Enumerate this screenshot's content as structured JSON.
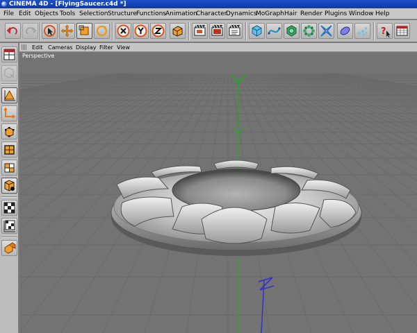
{
  "window": {
    "title": "CINEMA 4D - [FlyingSaucer.c4d *]"
  },
  "menubar": {
    "items": [
      "File",
      "Edit",
      "Objects",
      "Tools",
      "Selection",
      "Structure",
      "Functions",
      "Animation",
      "Character",
      "Dynamics",
      "MoGraph",
      "Hair",
      "Render",
      "Plugins",
      "Window",
      "Help"
    ]
  },
  "toolbar": {
    "buttons": [
      "undo-icon",
      "redo-icon",
      "live-selection-icon",
      "move-icon",
      "scale-icon",
      "rotate-icon",
      "x-axis-lock-icon",
      "y-axis-lock-icon",
      "z-axis-lock-icon",
      "coordinate-system-icon",
      "render-view-icon",
      "render-picture-viewer-icon",
      "render-settings-icon",
      "cube-primitive-icon",
      "spline-icon",
      "nurbs-icon",
      "array-icon",
      "deformer-icon",
      "scene-object-icon",
      "particle-icon",
      "help-icon",
      "attribute-manager-icon"
    ]
  },
  "leftbar": {
    "buttons": [
      "viewport-layout-icon",
      "make-editable-icon",
      "model-mode-icon",
      "object-axis-icon",
      "points-mode-icon",
      "edges-mode-icon",
      "polygons-mode-icon",
      "texture-mode-icon",
      "uv-points-icon",
      "uv-polygons-icon",
      "animation-icon"
    ]
  },
  "viewport": {
    "menu": [
      "Edit",
      "Cameras",
      "Display",
      "Filter",
      "View"
    ],
    "label": "Perspective",
    "axes": {
      "y": "Y",
      "z": "Z"
    }
  },
  "colors": {
    "titlebar": "#0d3aa8",
    "viewport_bg": "#6f6f6f",
    "grid": "#7a7a7a",
    "y_axis": "#2ea02e",
    "z_axis": "#3232c8",
    "toolbar_accent": "#d9531e"
  }
}
